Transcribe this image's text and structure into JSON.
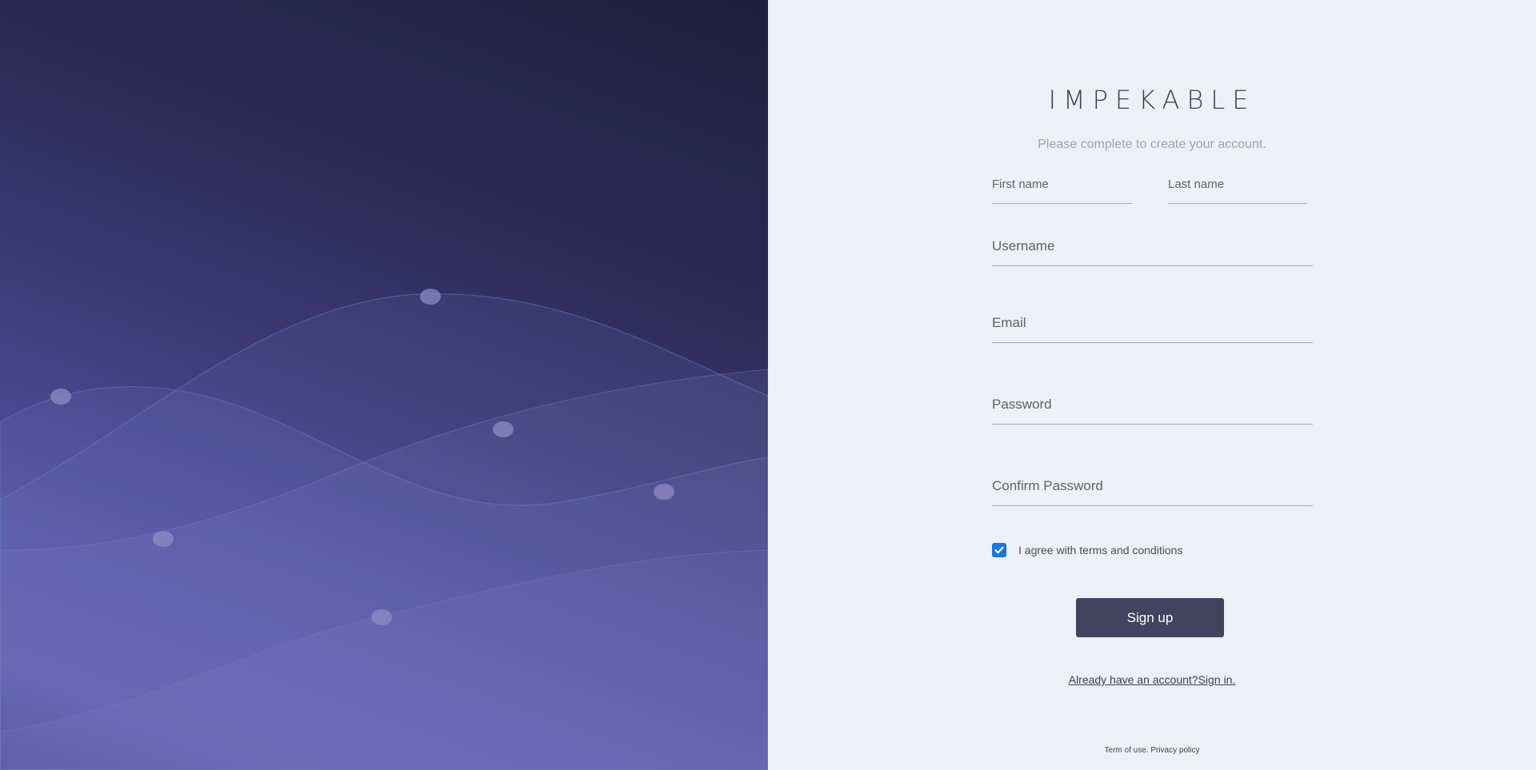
{
  "brand": {
    "name": "IMPEKABLE",
    "subtitle": "Please complete to create your account."
  },
  "form": {
    "first_name_placeholder": "First name",
    "last_name_placeholder": "Last name",
    "username_placeholder": "Username",
    "email_placeholder": "Email",
    "password_placeholder": "Password",
    "confirm_password_placeholder": "Confirm Password",
    "terms_label": "I agree with terms and conditions",
    "terms_checked": true,
    "submit_label": "Sign up"
  },
  "signin": {
    "prompt": "Already have an account?",
    "link_label": "Sign in."
  },
  "footer": {
    "terms_link": "Term of use.",
    "privacy_link": "Privacy policy"
  },
  "colors": {
    "button_bg": "#44435e",
    "page_bg": "#eff0f7",
    "checkbox_accent": "#1a73e8",
    "left_panel_dark": "#1f1f3d",
    "left_panel_light": "#5f59ae"
  }
}
